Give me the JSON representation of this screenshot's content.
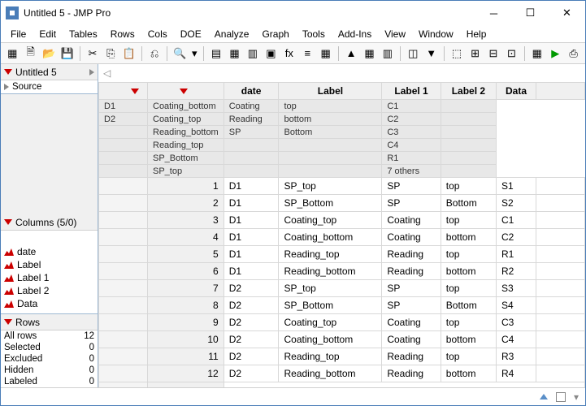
{
  "window": {
    "title": "Untitled 5 - JMP Pro"
  },
  "menu": [
    "File",
    "Edit",
    "Tables",
    "Rows",
    "Cols",
    "DOE",
    "Analyze",
    "Graph",
    "Tools",
    "Add-Ins",
    "View",
    "Window",
    "Help"
  ],
  "sidebar": {
    "table_name": "Untitled 5",
    "source_label": "Source",
    "columns_header": "Columns (5/0)",
    "columns": [
      "date",
      "Label",
      "Label 1",
      "Label 2",
      "Data"
    ],
    "rows_header": "Rows",
    "row_stats": [
      {
        "label": "All rows",
        "value": "12"
      },
      {
        "label": "Selected",
        "value": "0"
      },
      {
        "label": "Excluded",
        "value": "0"
      },
      {
        "label": "Hidden",
        "value": "0"
      },
      {
        "label": "Labeled",
        "value": "0"
      }
    ]
  },
  "grid": {
    "headers": [
      "date",
      "Label",
      "Label 1",
      "Label 2",
      "Data"
    ],
    "filters": [
      [
        "D1",
        "Coating_bottom",
        "Coating",
        "top",
        "C1"
      ],
      [
        "D2",
        "Coating_top",
        "Reading",
        "bottom",
        "C2"
      ],
      [
        "",
        "Reading_bottom",
        "SP",
        "Bottom",
        "C3"
      ],
      [
        "",
        "Reading_top",
        "",
        "",
        "C4"
      ],
      [
        "",
        "SP_Bottom",
        "",
        "",
        "R1"
      ],
      [
        "",
        "SP_top",
        "",
        "",
        "7 others"
      ]
    ],
    "rows": [
      {
        "n": "1",
        "c": [
          "D1",
          "SP_top",
          "SP",
          "top",
          "S1"
        ]
      },
      {
        "n": "2",
        "c": [
          "D1",
          "SP_Bottom",
          "SP",
          "Bottom",
          "S2"
        ]
      },
      {
        "n": "3",
        "c": [
          "D1",
          "Coating_top",
          "Coating",
          "top",
          "C1"
        ]
      },
      {
        "n": "4",
        "c": [
          "D1",
          "Coating_bottom",
          "Coating",
          "bottom",
          "C2"
        ]
      },
      {
        "n": "5",
        "c": [
          "D1",
          "Reading_top",
          "Reading",
          "top",
          "R1"
        ]
      },
      {
        "n": "6",
        "c": [
          "D1",
          "Reading_bottom",
          "Reading",
          "bottom",
          "R2"
        ]
      },
      {
        "n": "7",
        "c": [
          "D2",
          "SP_top",
          "SP",
          "top",
          "S3"
        ]
      },
      {
        "n": "8",
        "c": [
          "D2",
          "SP_Bottom",
          "SP",
          "Bottom",
          "S4"
        ]
      },
      {
        "n": "9",
        "c": [
          "D2",
          "Coating_top",
          "Coating",
          "top",
          "C3"
        ]
      },
      {
        "n": "10",
        "c": [
          "D2",
          "Coating_bottom",
          "Coating",
          "bottom",
          "C4"
        ]
      },
      {
        "n": "11",
        "c": [
          "D2",
          "Reading_top",
          "Reading",
          "top",
          "R3"
        ]
      },
      {
        "n": "12",
        "c": [
          "D2",
          "Reading_bottom",
          "Reading",
          "bottom",
          "R4"
        ]
      }
    ]
  }
}
